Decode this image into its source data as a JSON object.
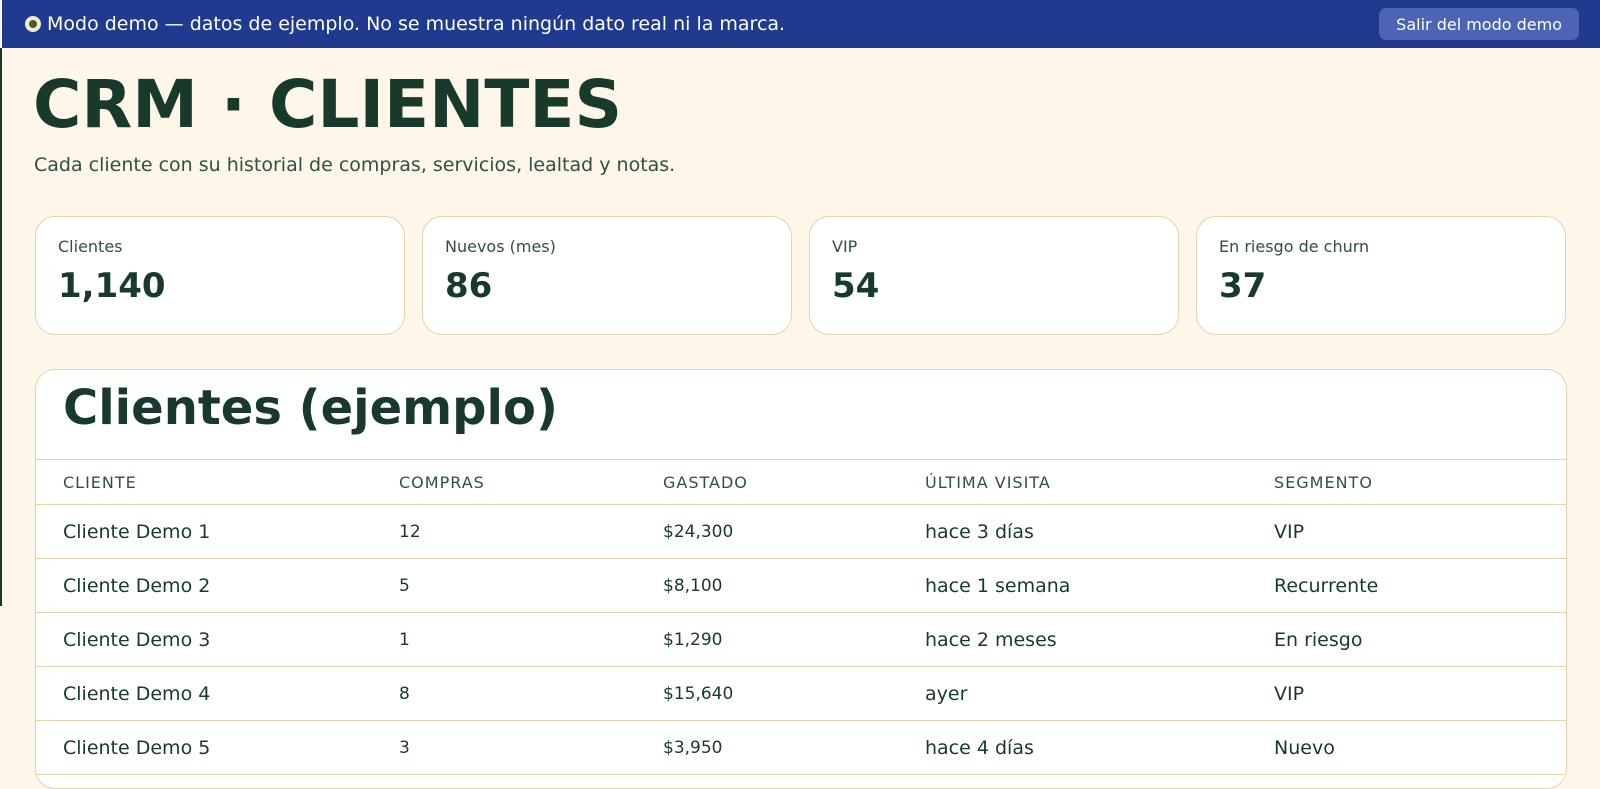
{
  "banner": {
    "icon": "eye-icon",
    "message": "Modo demo — datos de ejemplo. No se muestra ningún dato real ni la marca.",
    "exit_label": "Salir del modo demo",
    "bg_color": "#1f3a8f"
  },
  "page": {
    "title": "CRM · CLIENTES",
    "subtitle": "Cada cliente con su historial de compras, servicios, lealtad y notas."
  },
  "kpis": [
    {
      "label": "Clientes",
      "value": "1,140"
    },
    {
      "label": "Nuevos (mes)",
      "value": "86"
    },
    {
      "label": "VIP",
      "value": "54"
    },
    {
      "label": "En riesgo de churn",
      "value": "37"
    }
  ],
  "clients_table": {
    "title": "Clientes (ejemplo)",
    "columns": [
      "CLIENTE",
      "COMPRAS",
      "GASTADO",
      "ÚLTIMA VISITA",
      "SEGMENTO"
    ],
    "rows": [
      [
        "Cliente Demo 1",
        "12",
        "$24,300",
        "hace 3 días",
        "VIP"
      ],
      [
        "Cliente Demo 2",
        "5",
        "$8,100",
        "hace 1 semana",
        "Recurrente"
      ],
      [
        "Cliente Demo 3",
        "1",
        "$1,290",
        "hace 2 meses",
        "En riesgo"
      ],
      [
        "Cliente Demo 4",
        "8",
        "$15,640",
        "ayer",
        "VIP"
      ],
      [
        "Cliente Demo 5",
        "3",
        "$3,950",
        "hace 4 días",
        "Nuevo"
      ]
    ]
  }
}
